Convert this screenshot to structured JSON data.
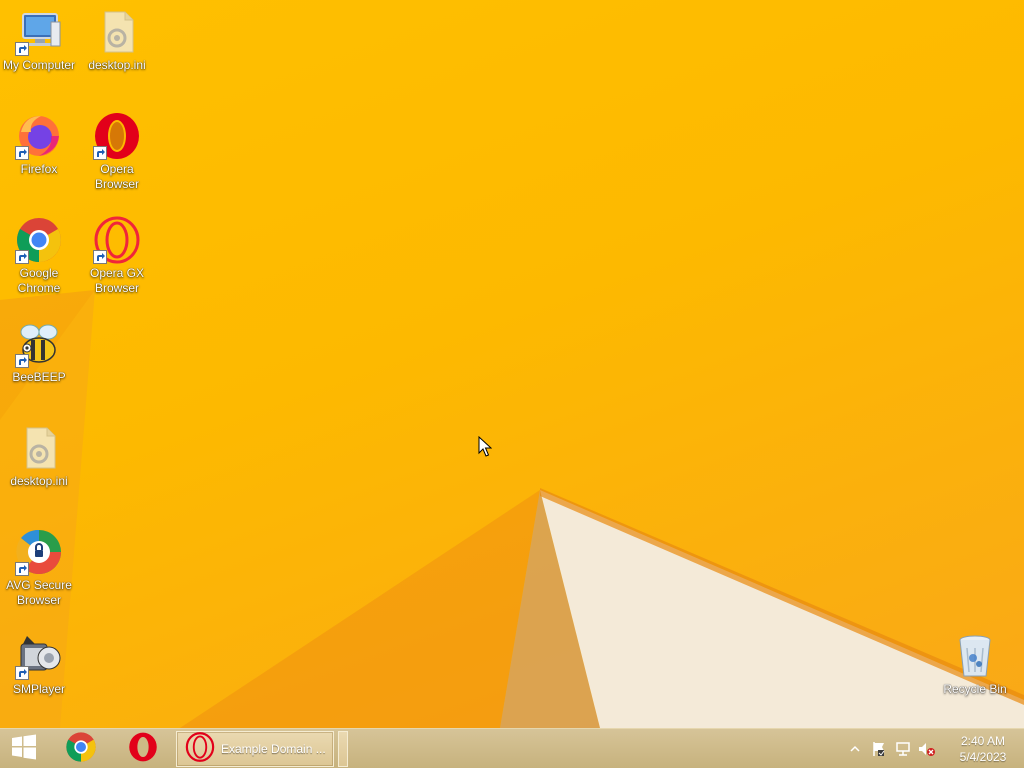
{
  "desktop": {
    "icons": [
      {
        "label": "My Computer",
        "icon": "computer-icon",
        "shortcut": true
      },
      {
        "label": "desktop.ini",
        "icon": "settings-file-icon",
        "shortcut": false
      },
      {
        "label": "Firefox",
        "icon": "firefox-icon",
        "shortcut": true
      },
      {
        "label": "Opera Browser",
        "icon": "opera-icon",
        "shortcut": true
      },
      {
        "label": "Google Chrome",
        "icon": "chrome-icon",
        "shortcut": true
      },
      {
        "label": "Opera GX Browser",
        "icon": "opera-gx-icon",
        "shortcut": true
      },
      {
        "label": "BeeBEEP",
        "icon": "beebeep-icon",
        "shortcut": true
      },
      {
        "label": "desktop.ini",
        "icon": "settings-file-icon",
        "shortcut": false
      },
      {
        "label": "AVG Secure Browser",
        "icon": "avg-secure-browser-icon",
        "shortcut": true
      },
      {
        "label": "SMPlayer",
        "icon": "smplayer-icon",
        "shortcut": true
      },
      {
        "label": "Recycle Bin",
        "icon": "recycle-bin-icon",
        "shortcut": false
      }
    ]
  },
  "taskbar": {
    "start_icon": "windows-logo-icon",
    "pinned": [
      {
        "name": "Google Chrome",
        "icon": "chrome-icon"
      },
      {
        "name": "Opera",
        "icon": "opera-icon"
      }
    ],
    "active_window": {
      "title": "Example Domain ...",
      "icon": "opera-icon"
    },
    "tray": {
      "icons": [
        "show-hidden-icons-chevron",
        "action-center-flag-icon",
        "network-icon",
        "volume-muted-icon"
      ],
      "time": "2:40 AM",
      "date": "5/4/2023"
    }
  },
  "colors": {
    "wallpaper": "#fdb900",
    "taskbar": "#cdb985"
  }
}
